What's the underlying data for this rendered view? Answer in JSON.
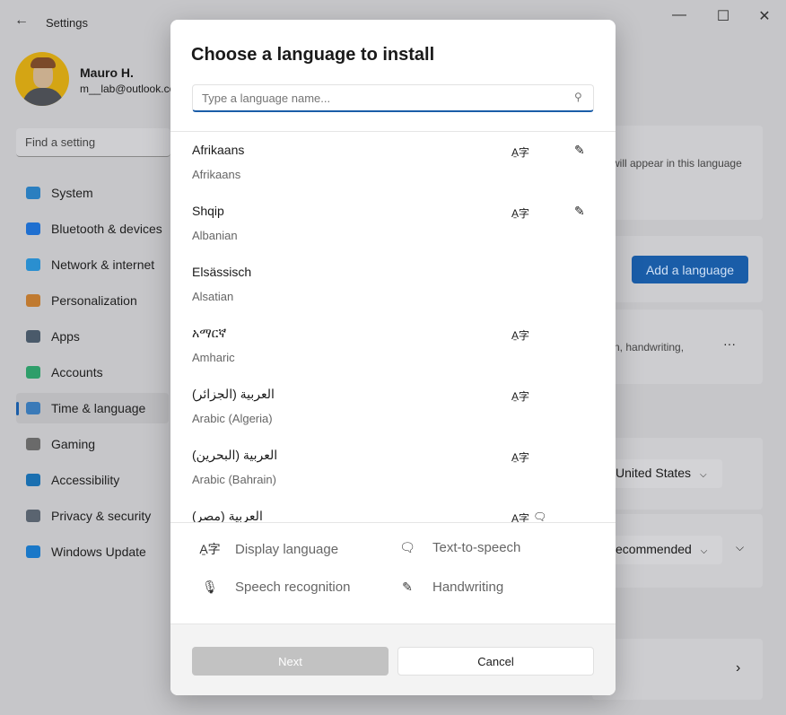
{
  "window": {
    "title": "Settings",
    "back_icon": "arrow-left-icon",
    "minimize": "—",
    "maximize": "☐",
    "close": "✕"
  },
  "user": {
    "name": "Mauro H.",
    "email": "m__lab@outlook.com"
  },
  "search": {
    "placeholder": "Find a setting"
  },
  "sidebar": {
    "items": [
      {
        "label": "System",
        "icon": "monitor-icon",
        "color": "#2b7fc0"
      },
      {
        "label": "Bluetooth & devices",
        "icon": "bluetooth-icon",
        "color": "#1f6fd0"
      },
      {
        "label": "Network & internet",
        "icon": "wifi-icon",
        "color": "#2a8fd0"
      },
      {
        "label": "Personalization",
        "icon": "brush-icon",
        "color": "#c07a30"
      },
      {
        "label": "Apps",
        "icon": "apps-icon",
        "color": "#4a5a6a"
      },
      {
        "label": "Accounts",
        "icon": "person-icon",
        "color": "#2e9e6a"
      },
      {
        "label": "Time & language",
        "icon": "globe-clock-icon",
        "color": "#3a7ab8",
        "selected": true
      },
      {
        "label": "Gaming",
        "icon": "gamepad-icon",
        "color": "#6a6a6a"
      },
      {
        "label": "Accessibility",
        "icon": "accessibility-icon",
        "color": "#1a6fb0"
      },
      {
        "label": "Privacy & security",
        "icon": "shield-icon",
        "color": "#5a6470"
      },
      {
        "label": "Windows Update",
        "icon": "update-icon",
        "color": "#1a78c8"
      }
    ]
  },
  "background": {
    "card1_text": "will appear in this language",
    "add_language": "Add a language",
    "card3_text": "n, handwriting,",
    "more": "···",
    "region": "United States",
    "format": "ecommended"
  },
  "dialog": {
    "title": "Choose a language to install",
    "search_placeholder": "Type a language name...",
    "languages": [
      {
        "name": "Afrikaans",
        "english": "Afrikaans",
        "display": true,
        "handwriting": true
      },
      {
        "name": "Shqip",
        "english": "Albanian",
        "display": true,
        "handwriting": true
      },
      {
        "name": "Elsässisch",
        "english": "Alsatian"
      },
      {
        "name": "አማርኛ",
        "english": "Amharic",
        "display": true
      },
      {
        "name": "العربية (الجزائر)",
        "english": "Arabic (Algeria)",
        "display": true
      },
      {
        "name": "العربية (البحرين)",
        "english": "Arabic (Bahrain)",
        "display": true
      },
      {
        "name": "العربية (مصر)",
        "english": "",
        "display": true,
        "tts": true
      }
    ],
    "legend": {
      "display": "Display language",
      "tts": "Text-to-speech",
      "speech": "Speech recognition",
      "handwriting": "Handwriting"
    },
    "next": "Next",
    "cancel": "Cancel"
  },
  "colors": {
    "accent": "#1a5da8"
  }
}
